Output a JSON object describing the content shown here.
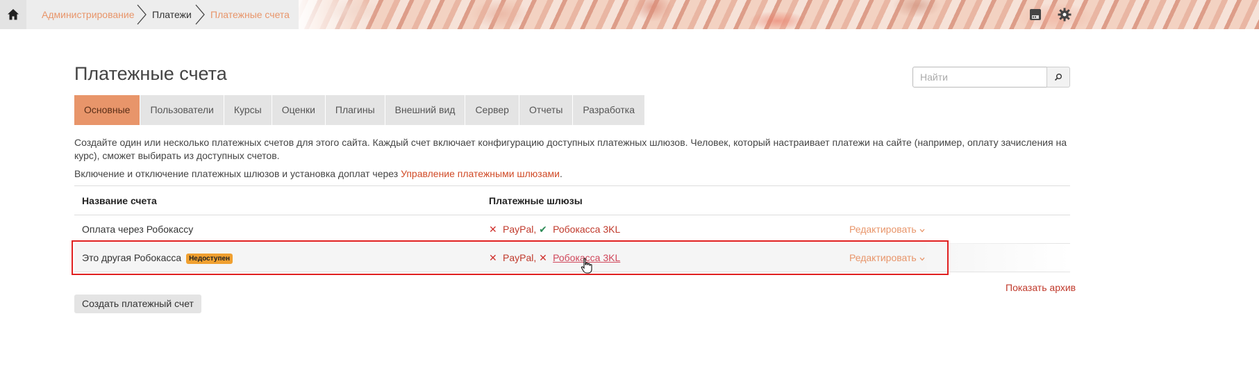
{
  "breadcrumb": {
    "items": [
      {
        "label": "Администрирование"
      },
      {
        "label": "Платежи"
      },
      {
        "label": "Платежные счета"
      }
    ]
  },
  "page": {
    "title": "Платежные счета"
  },
  "search": {
    "placeholder": "Найти"
  },
  "tabs": [
    {
      "label": "Основные",
      "active": true
    },
    {
      "label": "Пользователи"
    },
    {
      "label": "Курсы"
    },
    {
      "label": "Оценки"
    },
    {
      "label": "Плагины"
    },
    {
      "label": "Внешний вид"
    },
    {
      "label": "Сервер"
    },
    {
      "label": "Отчеты"
    },
    {
      "label": "Разработка"
    }
  ],
  "intro": {
    "paragraph": "Создайте один или несколько платежных счетов для этого сайта. Каждый счет включает конфигурацию доступных платежных шлюзов. Человек, который настраивает платежи на сайте (например, оплату зачисления на курс), сможет выбирать из доступных счетов.",
    "gateways_prefix": "Включение и отключение платежных шлюзов и установка доплат через ",
    "gateways_link": "Управление платежными шлюзами",
    "gateways_suffix": "."
  },
  "table": {
    "headers": {
      "name": "Название счета",
      "gateways": "Платежные шлюзы"
    },
    "rows": [
      {
        "name": "Оплата через Робокассу",
        "badge": "",
        "gateways": [
          {
            "name": "PayPal",
            "enabled": false,
            "sep": ","
          },
          {
            "name": "Робокасса 3KL",
            "enabled": true,
            "sep": ""
          }
        ],
        "edit": "Редактировать"
      },
      {
        "name": "Это другая Робокасса",
        "badge": "Недоступен",
        "gateways": [
          {
            "name": "PayPal",
            "enabled": false,
            "sep": ","
          },
          {
            "name": "Робокасса 3KL",
            "enabled": false,
            "sep": ""
          }
        ],
        "edit": "Редактировать"
      }
    ]
  },
  "actions": {
    "show_archive": "Показать архив",
    "create_account": "Создать платежный счет"
  },
  "marks": {
    "enabled": "✔",
    "disabled": "✕"
  },
  "colors": {
    "accent": "#e8956a",
    "link": "#c0392b",
    "badge": "#f0a030",
    "highlight": "#e02020"
  }
}
